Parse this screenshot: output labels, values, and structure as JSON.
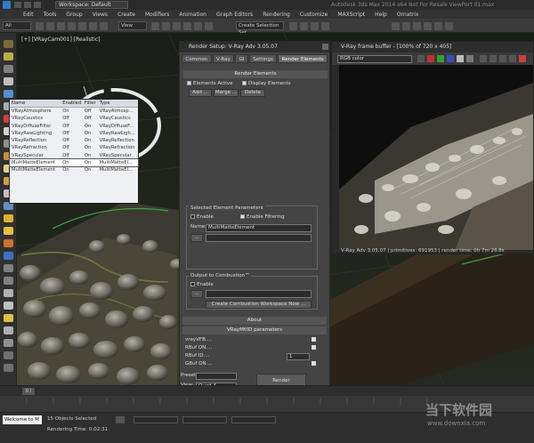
{
  "titlebar": {
    "workspace": "Workspace: Default",
    "title": "Autodesk 3ds Max 2014 x64    Not For Resale    ViewPort 01.max"
  },
  "menu": [
    "Edit",
    "Tools",
    "Group",
    "Views",
    "Create",
    "Modifiers",
    "Animation",
    "Graph Editors",
    "Rendering",
    "Customize",
    "MAXScript",
    "Help",
    "Ornatrix"
  ],
  "toolbar": {
    "filter": "All",
    "view": "View",
    "selection_set": "Create Selection Set"
  },
  "viewport": {
    "label": "[+] [VRayCam001] [Realistic]"
  },
  "render_setup": {
    "title": "Render Setup: V-Ray Adv 3.05.07",
    "tabs": [
      "Common",
      "V-Ray",
      "GI",
      "Settings",
      "Render Elements"
    ],
    "render_elements_header": "Render Elements",
    "elements_active": "Elements Active",
    "display_elements": "Display Elements",
    "add_btn": "Add ...",
    "merge_btn": "Merge ...",
    "delete_btn": "Delete",
    "table_headers": [
      "Name",
      "Enabled",
      "Filter",
      "Type"
    ],
    "rows": [
      {
        "name": "VRayAtmosphere",
        "enabled": "On",
        "filter": "Off",
        "type": "VRayAtmosp..."
      },
      {
        "name": "VRayCaustics",
        "enabled": "Off",
        "filter": "Off",
        "type": "VRayCaustics"
      },
      {
        "name": "VRayDiffuseFilter",
        "enabled": "Off",
        "filter": "On",
        "type": "VRayDiffuseF..."
      },
      {
        "name": "VRayRawLighting",
        "enabled": "Off",
        "filter": "On",
        "type": "VRayRawLigh..."
      },
      {
        "name": "VRayReflection",
        "enabled": "Off",
        "filter": "On",
        "type": "VRayReflection"
      },
      {
        "name": "VRayRefraction",
        "enabled": "Off",
        "filter": "On",
        "type": "VRayRefraction"
      },
      {
        "name": "VRaySpecular",
        "enabled": "Off",
        "filter": "On",
        "type": "VRaySpecular"
      },
      {
        "name": "MultiMatteElement",
        "enabled": "On",
        "filter": "On",
        "type": "MultiMatteEl..."
      },
      {
        "name": "MultiMatteElement",
        "enabled": "On",
        "filter": "On",
        "type": "MultiMatteEl..."
      }
    ],
    "selected_params_header": "Selected Element Parameters",
    "enable": "Enable",
    "enable_filtering": "Enable Filtering",
    "name_label": "Name:",
    "name_value": "MultiMatteElement",
    "path_btn": "...",
    "output_combustion": "Output to Combustion™",
    "combustion_enable": "Enable",
    "create_combustion_btn": "Create Combustion Workspace Now ...",
    "about_header": "About",
    "vraymtlid_header": "VRayMtlID parameters",
    "params": [
      "vrayVFB....",
      "RBuf ON....",
      "RBuf ID....",
      "GBuf ON...."
    ],
    "param_value": "1",
    "preset_label": "Preset:",
    "view_label": "View:",
    "view_value": "Quad 4 - VRayC",
    "render_btn": "Render"
  },
  "frame_buffer": {
    "title": "V-Ray frame buffer - [100% of 720 x 405]",
    "channel": "RGB color",
    "status": "V-Ray Adv 3.05.07  |  primitives: 691953  |  render time: 0h 7m 26.8s"
  },
  "timeline": {
    "frame": "0 / 100"
  },
  "status": {
    "welcome": "Welcome to M",
    "objects_selected": "15 Objects Selected",
    "render_time": "Rendering Time: 0:02:31",
    "watermark": "当下软件园",
    "watermark_url": "www.downxia.com"
  },
  "colors": {
    "accent_blue": "#2d7dc8",
    "panel": "#444444"
  }
}
